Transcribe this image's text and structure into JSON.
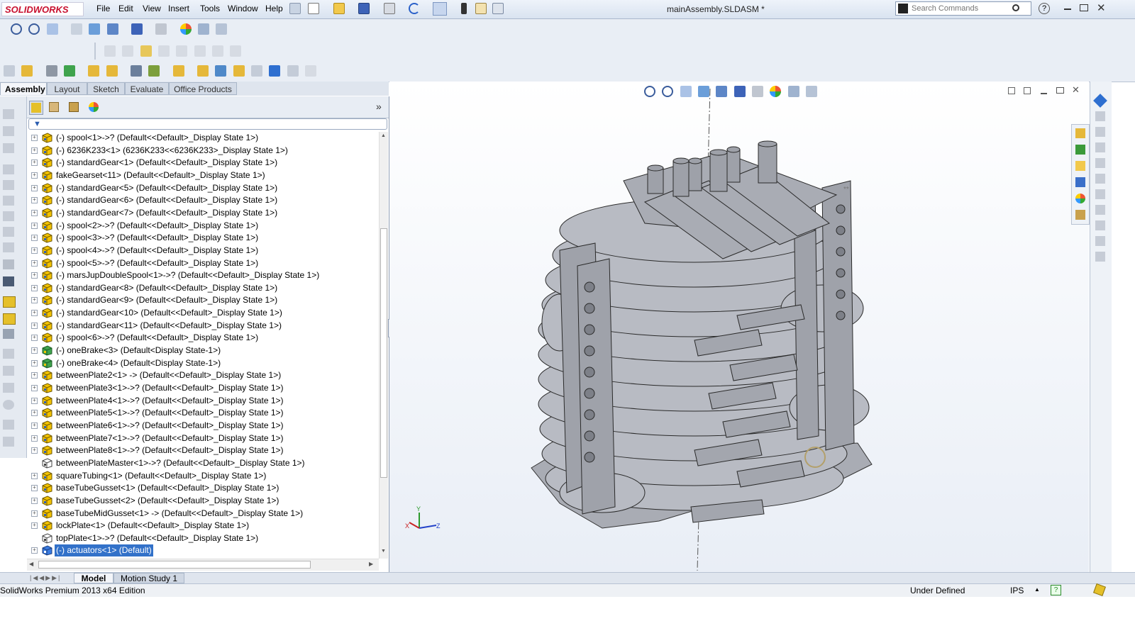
{
  "app": {
    "logo_text": "SOLIDWORKS",
    "doc_title": "mainAssembly.SLDASM *"
  },
  "menu": [
    "File",
    "Edit",
    "View",
    "Insert",
    "Tools",
    "Window",
    "Help"
  ],
  "search": {
    "placeholder": "Search Commands"
  },
  "command_tabs": [
    "Assembly",
    "Layout",
    "Sketch",
    "Evaluate",
    "Office Products"
  ],
  "tree": {
    "items": [
      {
        "label": "(-) spool<1>->? (Default<<Default>_Display State 1>)",
        "icon": "part-icon"
      },
      {
        "label": "(-) 6236K233<1> (6236K233<<6236K233>_Display State 1>)",
        "icon": "part-icon"
      },
      {
        "label": "(-) standardGear<1> (Default<<Default>_Display State 1>)",
        "icon": "part-icon"
      },
      {
        "label": "fakeGearset<11> (Default<<Default>_Display State 1>)",
        "icon": "part-icon"
      },
      {
        "label": "(-) standardGear<5> (Default<<Default>_Display State 1>)",
        "icon": "part-icon"
      },
      {
        "label": "(-) standardGear<6> (Default<<Default>_Display State 1>)",
        "icon": "part-icon"
      },
      {
        "label": "(-) standardGear<7> (Default<<Default>_Display State 1>)",
        "icon": "part-icon"
      },
      {
        "label": "(-) spool<2>->? (Default<<Default>_Display State 1>)",
        "icon": "part-icon"
      },
      {
        "label": "(-) spool<3>->? (Default<<Default>_Display State 1>)",
        "icon": "part-icon"
      },
      {
        "label": "(-) spool<4>->? (Default<<Default>_Display State 1>)",
        "icon": "part-icon"
      },
      {
        "label": "(-) spool<5>->? (Default<<Default>_Display State 1>)",
        "icon": "part-icon"
      },
      {
        "label": "(-) marsJupDoubleSpool<1>->? (Default<<Default>_Display State 1>)",
        "icon": "part-icon"
      },
      {
        "label": "(-) standardGear<8> (Default<<Default>_Display State 1>)",
        "icon": "part-icon"
      },
      {
        "label": "(-) standardGear<9> (Default<<Default>_Display State 1>)",
        "icon": "part-icon"
      },
      {
        "label": "(-) standardGear<10> (Default<<Default>_Display State 1>)",
        "icon": "part-icon"
      },
      {
        "label": "(-) standardGear<11> (Default<<Default>_Display State 1>)",
        "icon": "part-icon"
      },
      {
        "label": "(-) spool<6>->? (Default<<Default>_Display State 1>)",
        "icon": "part-icon"
      },
      {
        "label": "(-) oneBrake<3> (Default<Display State-1>)",
        "icon": "subassembly-icon"
      },
      {
        "label": "(-) oneBrake<4> (Default<Display State-1>)",
        "icon": "subassembly-icon"
      },
      {
        "label": "betweenPlate2<1> -> (Default<<Default>_Display State 1>)",
        "icon": "part-icon"
      },
      {
        "label": "betweenPlate3<1>->? (Default<<Default>_Display State 1>)",
        "icon": "part-icon"
      },
      {
        "label": "betweenPlate4<1>->? (Default<<Default>_Display State 1>)",
        "icon": "part-icon"
      },
      {
        "label": "betweenPlate5<1>->? (Default<<Default>_Display State 1>)",
        "icon": "part-icon"
      },
      {
        "label": "betweenPlate6<1>->? (Default<<Default>_Display State 1>)",
        "icon": "part-icon"
      },
      {
        "label": "betweenPlate7<1>->? (Default<<Default>_Display State 1>)",
        "icon": "part-icon"
      },
      {
        "label": "betweenPlate8<1>->? (Default<<Default>_Display State 1>)",
        "icon": "part-icon"
      },
      {
        "label": "betweenPlateMaster<1>->? (Default<<Default>_Display State 1>)",
        "icon": "part-outline-icon"
      },
      {
        "label": "squareTubing<1> (Default<<Default>_Display State 1>)",
        "icon": "part-icon"
      },
      {
        "label": "baseTubeGusset<1> (Default<<Default>_Display State 1>)",
        "icon": "part-icon"
      },
      {
        "label": "baseTubeGusset<2> (Default<<Default>_Display State 1>)",
        "icon": "part-icon"
      },
      {
        "label": "baseTubeMidGusset<1> -> (Default<<Default>_Display State 1>)",
        "icon": "part-icon"
      },
      {
        "label": "lockPlate<1> (Default<<Default>_Display State 1>)",
        "icon": "part-icon"
      },
      {
        "label": "topPlate<1>->? (Default<<Default>_Display State 1>)",
        "icon": "part-outline-icon"
      },
      {
        "label": "(-) actuators<1> (Default)",
        "icon": "assembly-icon",
        "selected": true
      }
    ]
  },
  "bottom_tabs": [
    "Model",
    "Motion Study 1"
  ],
  "status": {
    "edition": "SolidWorks Premium 2013 x64 Edition",
    "state": "Under Defined",
    "units": "IPS"
  },
  "colors": {
    "accent": "#3271c9",
    "part_yellow": "#f2c200",
    "model_gray": "#9b9ea6"
  }
}
